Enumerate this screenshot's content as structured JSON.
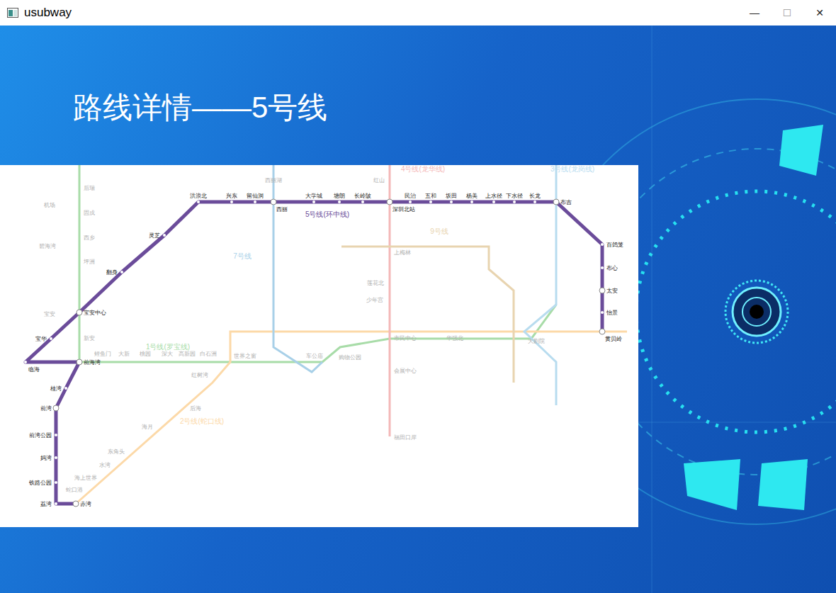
{
  "window": {
    "title": "usubway",
    "controls": [
      "—",
      "☐",
      "✕"
    ]
  },
  "heading": "路线详情——5号线",
  "map": {
    "line": {
      "name": "5号线(环中线)",
      "color": "#6b4c9a",
      "stations": [
        {
          "name": "赤湾",
          "interchange": true
        },
        {
          "name": "荔湾",
          "interchange": false
        },
        {
          "name": "铁路公园",
          "interchange": false
        },
        {
          "name": "妈湾",
          "interchange": false
        },
        {
          "name": "前湾公园",
          "interchange": false
        },
        {
          "name": "前湾",
          "interchange": true
        },
        {
          "name": "桂湾",
          "interchange": false
        },
        {
          "name": "前海湾",
          "interchange": true
        },
        {
          "name": "临海",
          "interchange": false
        },
        {
          "name": "宝华",
          "interchange": false
        },
        {
          "name": "宝安中心",
          "interchange": true
        },
        {
          "name": "翻身",
          "interchange": false
        },
        {
          "name": "灵芝",
          "interchange": false
        },
        {
          "name": "洪浪北",
          "interchange": false
        },
        {
          "name": "兴东",
          "interchange": false
        },
        {
          "name": "留仙洞",
          "interchange": false
        },
        {
          "name": "西丽",
          "interchange": true
        },
        {
          "name": "大学城",
          "interchange": false
        },
        {
          "name": "塘朗",
          "interchange": false
        },
        {
          "name": "长岭陂",
          "interchange": false
        },
        {
          "name": "深圳北站",
          "interchange": true
        },
        {
          "name": "民治",
          "interchange": false
        },
        {
          "name": "五和",
          "interchange": false
        },
        {
          "name": "坂田",
          "interchange": false
        },
        {
          "name": "杨美",
          "interchange": false
        },
        {
          "name": "上水径",
          "interchange": false
        },
        {
          "name": "下水径",
          "interchange": false
        },
        {
          "name": "长龙",
          "interchange": false
        },
        {
          "name": "布吉",
          "interchange": true
        },
        {
          "name": "百鸽笼",
          "interchange": false
        },
        {
          "name": "布心",
          "interchange": false
        },
        {
          "name": "太安",
          "interchange": true
        },
        {
          "name": "怡景",
          "interchange": false
        },
        {
          "name": "黄贝岭",
          "interchange": true
        }
      ]
    },
    "other_lines": [
      {
        "name": "1号线(罗宝线)",
        "color": "#a8dca8"
      },
      {
        "name": "2号线(蛇口线)",
        "color": "#fcd9a8"
      },
      {
        "name": "3号线(龙岗线)",
        "color": "#b8dcef"
      },
      {
        "name": "4号线(龙华线)",
        "color": "#f4b8b8"
      },
      {
        "name": "7号线",
        "color": "#a8d0e8"
      },
      {
        "name": "9号线",
        "color": "#e8d4b0"
      }
    ],
    "faded_stations": [
      "机场",
      "碧海湾",
      "宝安",
      "后瑞",
      "固戍",
      "西乡",
      "坪洲",
      "新安",
      "鲤鱼门",
      "大新",
      "桃园",
      "深大",
      "高新园",
      "白石洲",
      "世界之窗",
      "车公庙",
      "购物公园",
      "市民中心",
      "华强北",
      "大剧院",
      "会展中心",
      "福田口岸",
      "红树湾",
      "后海",
      "海月",
      "东角头",
      "水湾",
      "海上世界",
      "蛇口港",
      "西丽湖",
      "红山",
      "上梅林",
      "少年宫",
      "莲花北"
    ]
  }
}
